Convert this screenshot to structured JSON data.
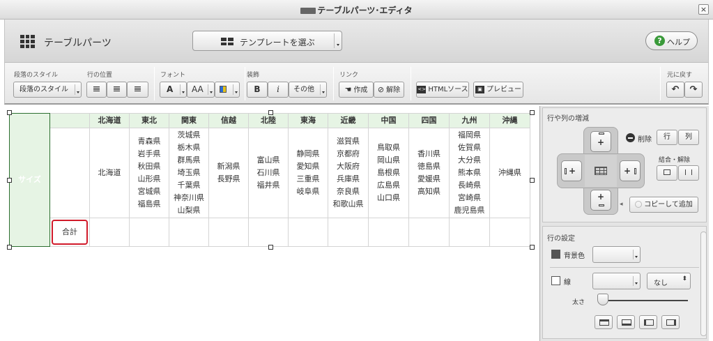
{
  "window": {
    "title": "テーブルパーツ･エディタ",
    "close_glyph": "×"
  },
  "header": {
    "app_title": "テーブルパーツ",
    "template_button": "テンプレートを選ぶ",
    "help_button": "ヘルプ",
    "help_glyph": "?"
  },
  "toolbar": {
    "groups": {
      "paragraph_style": "段落のスタイル",
      "row_position": "行の位置",
      "font": "フォント",
      "decoration": "装飾",
      "link": "リンク",
      "undo": "元に戻す"
    },
    "paragraph_style_button": "段落のスタイル",
    "font_size_glyph": "A",
    "font_resize_glyph": "AA",
    "bold_glyph": "B",
    "italic_glyph": "i",
    "other_button": "その他",
    "create_link": "作成",
    "remove_link": "解除",
    "html_source": "HTMLソース",
    "preview": "プレビュー",
    "undo_glyph": "↶",
    "redo_glyph": "↷"
  },
  "table": {
    "side_header": "サイズ",
    "columns": [
      {
        "header": "北海道",
        "cell": "北海道"
      },
      {
        "header": "東北",
        "cell": "青森県\n岩手県\n秋田県\n山形県\n宮城県\n福島県"
      },
      {
        "header": "関東",
        "cell": "茨城県\n栃木県\n群馬県\n埼玉県\n千葉県\n神奈川県\n山梨県"
      },
      {
        "header": "信越",
        "cell": "新潟県\n長野県"
      },
      {
        "header": "北陸",
        "cell": "富山県\n石川県\n福井県"
      },
      {
        "header": "東海",
        "cell": "静岡県\n愛知県\n三重県\n岐阜県"
      },
      {
        "header": "近畿",
        "cell": "滋賀県\n京都府\n大阪府\n兵庫県\n奈良県\n和歌山県"
      },
      {
        "header": "中国",
        "cell": "鳥取県\n岡山県\n島根県\n広島県\n山口県"
      },
      {
        "header": "四国",
        "cell": "香川県\n徳島県\n愛媛県\n高知県"
      },
      {
        "header": "九州",
        "cell": "福岡県\n佐賀県\n大分県\n熊本県\n長崎県\n宮崎県\n鹿児島県"
      },
      {
        "header": "沖縄",
        "cell": "沖縄県"
      }
    ],
    "total_label": "合計"
  },
  "row_col_panel": {
    "title": "行や列の増減",
    "plus_glyph": "+",
    "delete_label": "削除",
    "delete_row": "行",
    "delete_col": "列",
    "merge_label": "結合・解除",
    "copy_add": "コピーして追加"
  },
  "row_settings": {
    "title": "行の設定",
    "bg_label": "背景色",
    "line_label": "線",
    "line_value": "なし",
    "thickness_label": "太さ",
    "slider_value": 0
  },
  "colors": {
    "side_header": "#348238",
    "header_bg": "#e6f4e4",
    "selected_border": "#d11a2a",
    "help_icon": "#3a9a3a"
  }
}
